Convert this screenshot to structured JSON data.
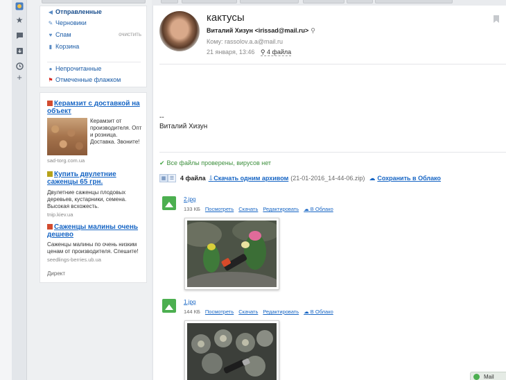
{
  "sidebar": {
    "folders": [
      {
        "label": "Отправленные",
        "icon": "sent-icon",
        "active": true
      },
      {
        "label": "Черновики",
        "icon": "draft-icon"
      },
      {
        "label": "Спам",
        "icon": "spam-icon",
        "action": "очистить"
      },
      {
        "label": "Корзина",
        "icon": "trash-icon"
      }
    ],
    "filters": [
      {
        "label": "Непрочитанные",
        "icon": "unread-dot-icon"
      },
      {
        "label": "Отмеченные флажком",
        "icon": "red-flag-icon"
      }
    ]
  },
  "ads": {
    "items": [
      {
        "title": "Керамзит с доставкой на объект",
        "text": "Керамзит от производителя. Опт и розница. Доставка. Звоните!",
        "domain": "sad-torg.com.ua"
      },
      {
        "title": "Купить двулетние саженцы 65 грн.",
        "text": "Двулетние саженцы плодовых деревьев, кустарники, семена. Высокая всхожесть.",
        "domain": "tnip.kiev.ua"
      },
      {
        "title": "Саженцы малины очень дешево",
        "text": "Саженцы малины по очень низким ценам от производителя. Спешите!",
        "domain": "seedlings-berries.ub.ua"
      }
    ],
    "footer": "Директ"
  },
  "message": {
    "subject": "кактусы",
    "sender": "Виталий Хизун <irissad@mail.ru>",
    "to": "Кому: rassolov.a.a@mail.ru",
    "date": "21 января, 13:46",
    "files_link": "4 файла",
    "body_dash": "--",
    "body_signature": "Виталий Хизун"
  },
  "attachments": {
    "av_status": "Все файлы проверены, вирусов нет",
    "count": "4 файла",
    "download_archive": "Скачать одним архивом",
    "archive_name": "(21-01-2016_14-44-06.zip)",
    "save_cloud": "Сохранить в Облако",
    "files": [
      {
        "name": "2.jpg",
        "size": "133 КБ",
        "view": "Посмотреть",
        "download": "Скачать",
        "edit": "Редактировать",
        "cloud": "В Облако"
      },
      {
        "name": "1.jpg",
        "size": "144 КБ",
        "view": "Посмотреть",
        "download": "Скачать",
        "edit": "Редактировать",
        "cloud": "В Облако"
      }
    ]
  },
  "status_pill": {
    "label": "Mail"
  }
}
